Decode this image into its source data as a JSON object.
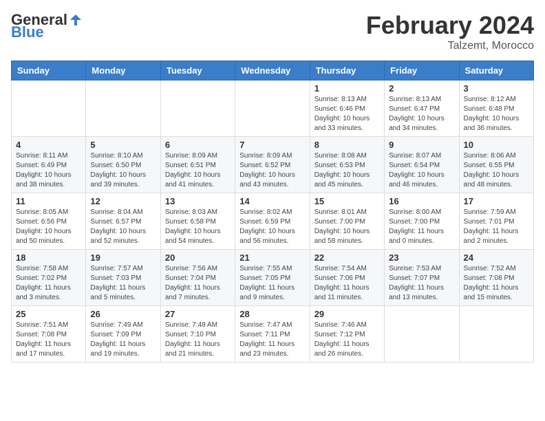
{
  "header": {
    "logo_general": "General",
    "logo_blue": "Blue",
    "month_title": "February 2024",
    "subtitle": "Talzemt, Morocco"
  },
  "weekdays": [
    "Sunday",
    "Monday",
    "Tuesday",
    "Wednesday",
    "Thursday",
    "Friday",
    "Saturday"
  ],
  "weeks": [
    [
      {
        "day": "",
        "info": ""
      },
      {
        "day": "",
        "info": ""
      },
      {
        "day": "",
        "info": ""
      },
      {
        "day": "",
        "info": ""
      },
      {
        "day": "1",
        "info": "Sunrise: 8:13 AM\nSunset: 6:46 PM\nDaylight: 10 hours and 33 minutes."
      },
      {
        "day": "2",
        "info": "Sunrise: 8:13 AM\nSunset: 6:47 PM\nDaylight: 10 hours and 34 minutes."
      },
      {
        "day": "3",
        "info": "Sunrise: 8:12 AM\nSunset: 6:48 PM\nDaylight: 10 hours and 36 minutes."
      }
    ],
    [
      {
        "day": "4",
        "info": "Sunrise: 8:11 AM\nSunset: 6:49 PM\nDaylight: 10 hours and 38 minutes."
      },
      {
        "day": "5",
        "info": "Sunrise: 8:10 AM\nSunset: 6:50 PM\nDaylight: 10 hours and 39 minutes."
      },
      {
        "day": "6",
        "info": "Sunrise: 8:09 AM\nSunset: 6:51 PM\nDaylight: 10 hours and 41 minutes."
      },
      {
        "day": "7",
        "info": "Sunrise: 8:09 AM\nSunset: 6:52 PM\nDaylight: 10 hours and 43 minutes."
      },
      {
        "day": "8",
        "info": "Sunrise: 8:08 AM\nSunset: 6:53 PM\nDaylight: 10 hours and 45 minutes."
      },
      {
        "day": "9",
        "info": "Sunrise: 8:07 AM\nSunset: 6:54 PM\nDaylight: 10 hours and 46 minutes."
      },
      {
        "day": "10",
        "info": "Sunrise: 8:06 AM\nSunset: 6:55 PM\nDaylight: 10 hours and 48 minutes."
      }
    ],
    [
      {
        "day": "11",
        "info": "Sunrise: 8:05 AM\nSunset: 6:56 PM\nDaylight: 10 hours and 50 minutes."
      },
      {
        "day": "12",
        "info": "Sunrise: 8:04 AM\nSunset: 6:57 PM\nDaylight: 10 hours and 52 minutes."
      },
      {
        "day": "13",
        "info": "Sunrise: 8:03 AM\nSunset: 6:58 PM\nDaylight: 10 hours and 54 minutes."
      },
      {
        "day": "14",
        "info": "Sunrise: 8:02 AM\nSunset: 6:59 PM\nDaylight: 10 hours and 56 minutes."
      },
      {
        "day": "15",
        "info": "Sunrise: 8:01 AM\nSunset: 7:00 PM\nDaylight: 10 hours and 58 minutes."
      },
      {
        "day": "16",
        "info": "Sunrise: 8:00 AM\nSunset: 7:00 PM\nDaylight: 11 hours and 0 minutes."
      },
      {
        "day": "17",
        "info": "Sunrise: 7:59 AM\nSunset: 7:01 PM\nDaylight: 11 hours and 2 minutes."
      }
    ],
    [
      {
        "day": "18",
        "info": "Sunrise: 7:58 AM\nSunset: 7:02 PM\nDaylight: 11 hours and 3 minutes."
      },
      {
        "day": "19",
        "info": "Sunrise: 7:57 AM\nSunset: 7:03 PM\nDaylight: 11 hours and 5 minutes."
      },
      {
        "day": "20",
        "info": "Sunrise: 7:56 AM\nSunset: 7:04 PM\nDaylight: 11 hours and 7 minutes."
      },
      {
        "day": "21",
        "info": "Sunrise: 7:55 AM\nSunset: 7:05 PM\nDaylight: 11 hours and 9 minutes."
      },
      {
        "day": "22",
        "info": "Sunrise: 7:54 AM\nSunset: 7:06 PM\nDaylight: 11 hours and 11 minutes."
      },
      {
        "day": "23",
        "info": "Sunrise: 7:53 AM\nSunset: 7:07 PM\nDaylight: 11 hours and 13 minutes."
      },
      {
        "day": "24",
        "info": "Sunrise: 7:52 AM\nSunset: 7:08 PM\nDaylight: 11 hours and 15 minutes."
      }
    ],
    [
      {
        "day": "25",
        "info": "Sunrise: 7:51 AM\nSunset: 7:08 PM\nDaylight: 11 hours and 17 minutes."
      },
      {
        "day": "26",
        "info": "Sunrise: 7:49 AM\nSunset: 7:09 PM\nDaylight: 11 hours and 19 minutes."
      },
      {
        "day": "27",
        "info": "Sunrise: 7:48 AM\nSunset: 7:10 PM\nDaylight: 11 hours and 21 minutes."
      },
      {
        "day": "28",
        "info": "Sunrise: 7:47 AM\nSunset: 7:11 PM\nDaylight: 11 hours and 23 minutes."
      },
      {
        "day": "29",
        "info": "Sunrise: 7:46 AM\nSunset: 7:12 PM\nDaylight: 11 hours and 26 minutes."
      },
      {
        "day": "",
        "info": ""
      },
      {
        "day": "",
        "info": ""
      }
    ]
  ]
}
